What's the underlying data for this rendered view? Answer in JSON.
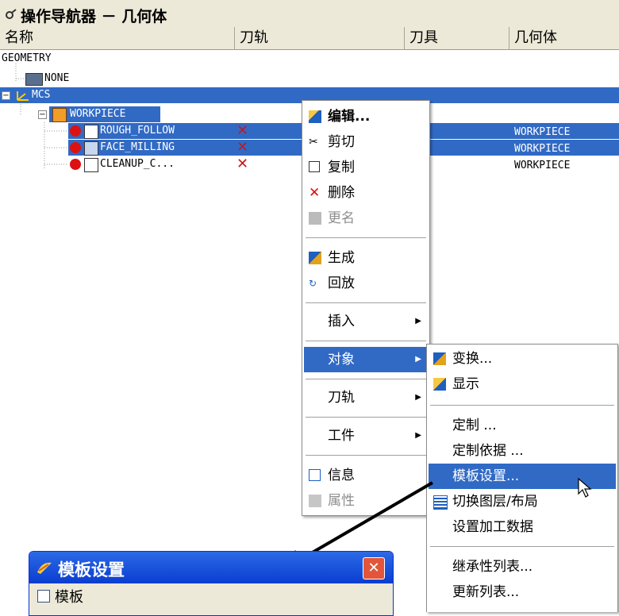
{
  "window": {
    "title": "操作导航器 － 几何体"
  },
  "columns": [
    {
      "label": "名称"
    },
    {
      "label": "刀轨"
    },
    {
      "label": "刀具"
    },
    {
      "label": "几何体"
    }
  ],
  "tree": {
    "root": "GEOMETRY",
    "none": "NONE",
    "mcs": "MCS",
    "workpiece": "WORKPIECE",
    "ops": [
      {
        "name": "ROUGH_FOLLOW",
        "status": "✕",
        "geometry": "WORKPIECE",
        "selected": true
      },
      {
        "name": "FACE_MILLING",
        "status": "✕",
        "geometry": "WORKPIECE",
        "selected": true
      },
      {
        "name": "CLEANUP_C...",
        "status": "✕",
        "geometry": "WORKPIECE",
        "selected": false
      }
    ]
  },
  "context_menu": {
    "items": [
      {
        "label": "编辑...",
        "icon": "edit-icon"
      },
      {
        "label": "剪切",
        "icon": "cut-icon"
      },
      {
        "label": "复制",
        "icon": "copy-icon"
      },
      {
        "label": "删除",
        "icon": "delete-icon"
      },
      {
        "label": "更名",
        "icon": "rename-icon",
        "disabled": true
      },
      {
        "label": "生成",
        "icon": "generate-icon"
      },
      {
        "label": "回放",
        "icon": "replay-icon"
      },
      {
        "label": "插入",
        "submenu": true
      },
      {
        "label": "对象",
        "submenu": true,
        "highlighted": true
      },
      {
        "label": "刀轨",
        "submenu": true
      },
      {
        "label": "工件",
        "submenu": true
      },
      {
        "label": "信息",
        "icon": "info-icon"
      },
      {
        "label": "属性",
        "icon": "properties-icon",
        "disabled": true
      }
    ]
  },
  "submenu": {
    "items": [
      {
        "label": "变换...",
        "icon": "transform-icon"
      },
      {
        "label": "显示",
        "icon": "display-icon"
      },
      {
        "label": "定制 ..."
      },
      {
        "label": "定制依据 ..."
      },
      {
        "label": "模板设置...",
        "highlighted": true
      },
      {
        "label": "切换图层/布局",
        "icon": "layer-icon"
      },
      {
        "label": "设置加工数据"
      },
      {
        "label": "继承性列表..."
      },
      {
        "label": "更新列表..."
      }
    ]
  },
  "dialog": {
    "title": "模板设置",
    "checkbox_label": "模板",
    "close": "✕"
  },
  "colors": {
    "selection": "#316ac5",
    "error": "#c21b1b",
    "chrome": "#ece9d8"
  }
}
